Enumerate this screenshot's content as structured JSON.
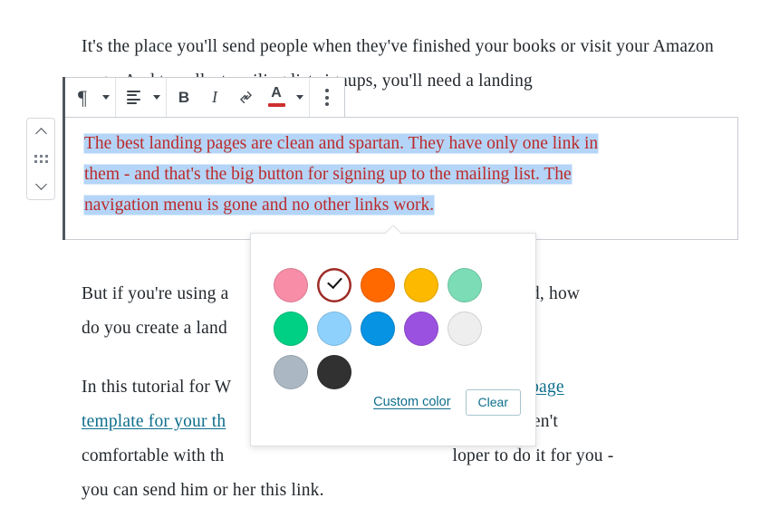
{
  "document": {
    "paragraph_1": "It's the place you'll send people when they've finished your books or visit your Amazon page. And to collect mailing list signups, you'll need a landing",
    "selected_paragraph_line_1": "The best landing pages are clean and spartan. They have only one link in",
    "selected_paragraph_line_2": "them - and that's the big button for signing up to the mailing list. The",
    "selected_paragraph_line_3": "navigation menu is gone and no other links work.",
    "paragraph_3": "But if you're using a          page included, how do you create a land",
    "paragraph_3_a": "But if you're using a",
    "paragraph_3_b": "page included, how",
    "paragraph_3_c": "do you create a land",
    "paragraph_4_a": "In this tutorial for W",
    "paragraph_4_link_1": "e a landing page",
    "paragraph_4_link_2": "template for your th",
    "paragraph_4_b": "so if you aren't",
    "paragraph_4_c": "comfortable with th",
    "paragraph_4_d": "loper to do it for you -",
    "paragraph_4_e": "you can send him or her this link.",
    "selected_text_color": "#bb2a2a",
    "selection_highlight_color": "#b4d5f7",
    "link_color": "#0d6e8c"
  },
  "block_mover": {
    "move_up_label": "Move up",
    "drag_label": "Drag",
    "move_down_label": "Move down"
  },
  "toolbar": {
    "block_type_label": "Paragraph",
    "block_type_icon": "pilcrow-icon",
    "block_type_caret_icon": "chevron-down-icon",
    "align_label": "Align text",
    "align_icon": "align-left-icon",
    "align_caret_icon": "chevron-down-icon",
    "bold_label": "B",
    "italic_label": "I",
    "link_icon": "link-icon",
    "text_color_label": "A",
    "text_color_swatch": "#cf2e2e",
    "text_color_caret_icon": "chevron-down-icon",
    "more_options_icon": "kebab-menu-icon"
  },
  "color_popover": {
    "swatches": [
      {
        "name": "pale-pink",
        "hex": "#F78DA7",
        "selected": false
      },
      {
        "name": "vivid-red",
        "hex": "#CF2E2E",
        "selected": true
      },
      {
        "name": "luminous-vivid-orange",
        "hex": "#FF6900",
        "selected": false
      },
      {
        "name": "luminous-vivid-amber",
        "hex": "#FCB900",
        "selected": false
      },
      {
        "name": "light-green-cyan",
        "hex": "#7BDCB5",
        "selected": false
      },
      {
        "name": "vivid-green-cyan",
        "hex": "#00D084",
        "selected": false
      },
      {
        "name": "pale-cyan-blue",
        "hex": "#8ED1FC",
        "selected": false
      },
      {
        "name": "vivid-cyan-blue",
        "hex": "#0693E3",
        "selected": false
      },
      {
        "name": "vivid-purple",
        "hex": "#9B51E0",
        "selected": false
      },
      {
        "name": "very-light-gray",
        "hex": "#EEEEEE",
        "selected": false
      },
      {
        "name": "cyan-bluish-gray",
        "hex": "#ABB8C3",
        "selected": false
      },
      {
        "name": "very-dark-gray",
        "hex": "#313131",
        "selected": false
      }
    ],
    "selected_ring_color": "#9E2B25",
    "custom_color_label": "Custom color",
    "clear_label": "Clear"
  }
}
